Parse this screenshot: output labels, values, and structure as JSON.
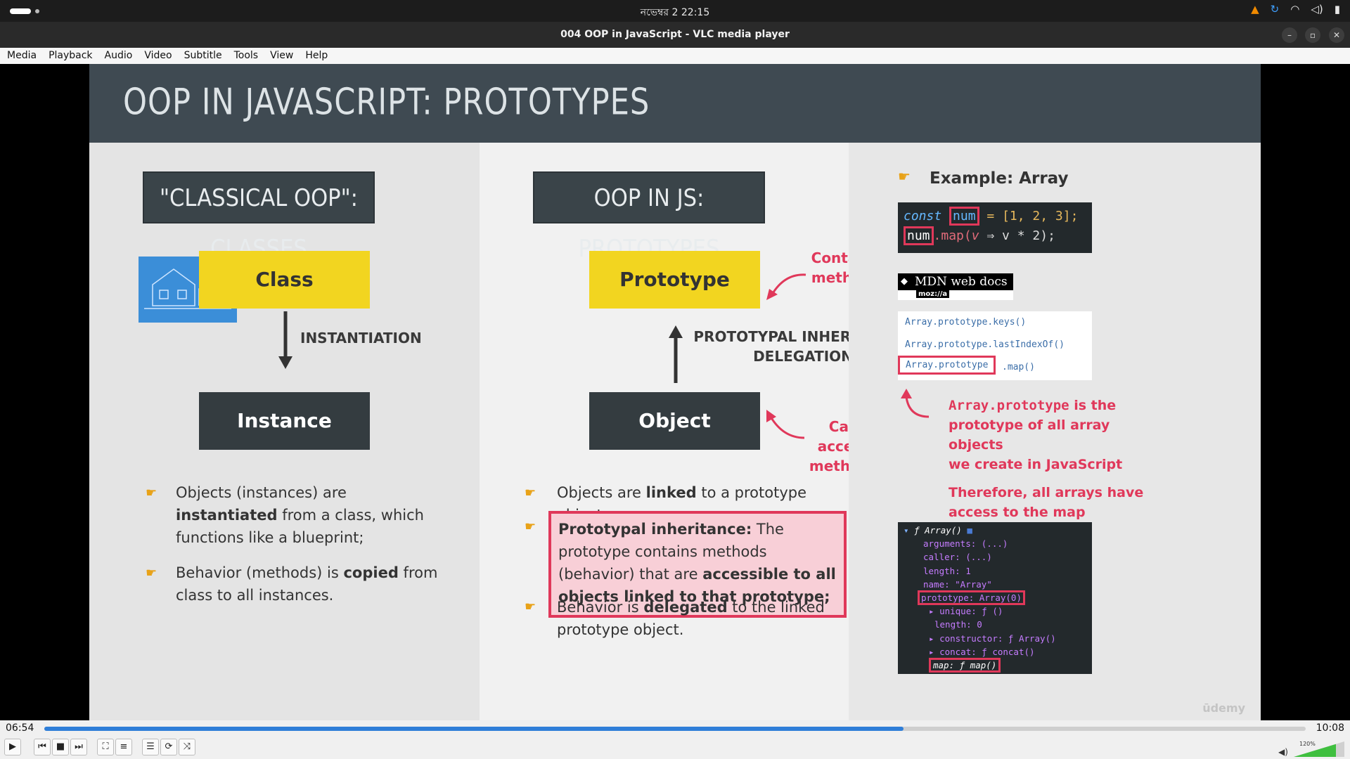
{
  "system": {
    "clock": "নভেম্বর 2  22:15"
  },
  "window": {
    "title": "004 OOP in JavaScript - VLC media player"
  },
  "menu": [
    "Media",
    "Playback",
    "Audio",
    "Video",
    "Subtitle",
    "Tools",
    "View",
    "Help"
  ],
  "slide": {
    "title": "OOP IN JAVASCRIPT: PROTOTYPES",
    "left": {
      "heading": "\"CLASSICAL OOP\": CLASSES",
      "class_label": "Class",
      "arrow_label": "INSTANTIATION",
      "instance_label": "Instance",
      "bullet1": [
        "Objects (instances) are ",
        "instantiated",
        " from a class, which functions like a blueprint;"
      ],
      "bullet2": [
        "Behavior (methods) is ",
        "copied",
        " from class to all instances."
      ]
    },
    "middle": {
      "heading": "OOP IN JS: PROTOTYPES",
      "prototype_label": "Prototype",
      "contains_note": "Contains methods",
      "arrow_label_1": "PROTOTYPAL INHERITANCE/",
      "arrow_label_2": "DELEGATION",
      "object_label": "Object",
      "access_note": "Can access methods",
      "bullet1": [
        "Objects are ",
        "linked",
        " to a prototype object;"
      ],
      "bullet2": [
        "Prototypal inheritance:",
        " The prototype contains methods (behavior) that are ",
        "accessible to all objects linked to that prototype;"
      ],
      "bullet3": [
        "Behavior is ",
        "delegated",
        " to the linked prototype object."
      ]
    },
    "right": {
      "example_title": "Example: Array",
      "code_line1": [
        "const",
        "num",
        "= [1, 2, 3];"
      ],
      "code_line2": [
        "num",
        ".map(",
        "v",
        " ⇒ v * 2);"
      ],
      "mdn_title": "MDN web docs",
      "mdn_sub": "moz://a",
      "mdn_items": [
        "Array.prototype.keys()",
        "Array.prototype.lastIndexOf()",
        "Array.prototype",
        ".map()"
      ],
      "note1_code": "Array.prototype",
      "note1_rest": " is the",
      "note1_line2": "prototype of all array objects",
      "note1_line3": "we create in JavaScript",
      "note2_line1": "Therefore, all arrays have",
      "note2_line2": "access to the map method!",
      "console": [
        "ƒ Array()",
        "arguments: (...)",
        "caller: (...)",
        "length: 1",
        "name: \"Array\"",
        "prototype: Array(0)",
        "unique: ƒ ()",
        "length: 0",
        "constructor: ƒ Array()",
        "concat: ƒ concat()",
        "map: ƒ map()"
      ],
      "watermark": "ūdemy"
    }
  },
  "player": {
    "elapsed": "06:54",
    "total": "10:08",
    "progress": 0.681,
    "volume_label": "120%"
  },
  "colors": {
    "accent": "#e0385a",
    "yellow": "#f2d520",
    "progress": "#2f7ed8"
  }
}
